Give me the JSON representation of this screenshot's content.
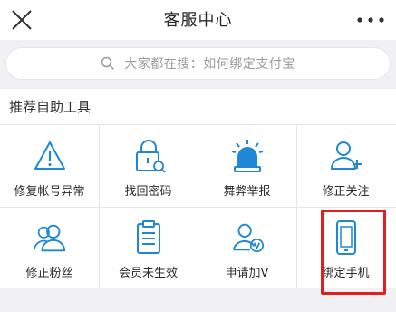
{
  "header": {
    "title": "客服中心"
  },
  "search": {
    "placeholder": "大家都在搜：如何绑定支付宝"
  },
  "section": {
    "title": "推荐自助工具"
  },
  "tools": [
    {
      "label": "修复帐号异常",
      "icon": "warning-icon"
    },
    {
      "label": "找回密码",
      "icon": "lock-icon"
    },
    {
      "label": "舞弊举报",
      "icon": "alarm-icon"
    },
    {
      "label": "修正关注",
      "icon": "user-add-icon"
    },
    {
      "label": "修正粉丝",
      "icon": "users-icon"
    },
    {
      "label": "会员未生效",
      "icon": "clipboard-icon"
    },
    {
      "label": "申请加V",
      "icon": "verified-user-icon"
    },
    {
      "label": "绑定手机",
      "icon": "phone-icon"
    }
  ],
  "colors": {
    "accent": "#1e88d6",
    "highlight": "#e02020",
    "background": "#f1f1f4"
  }
}
